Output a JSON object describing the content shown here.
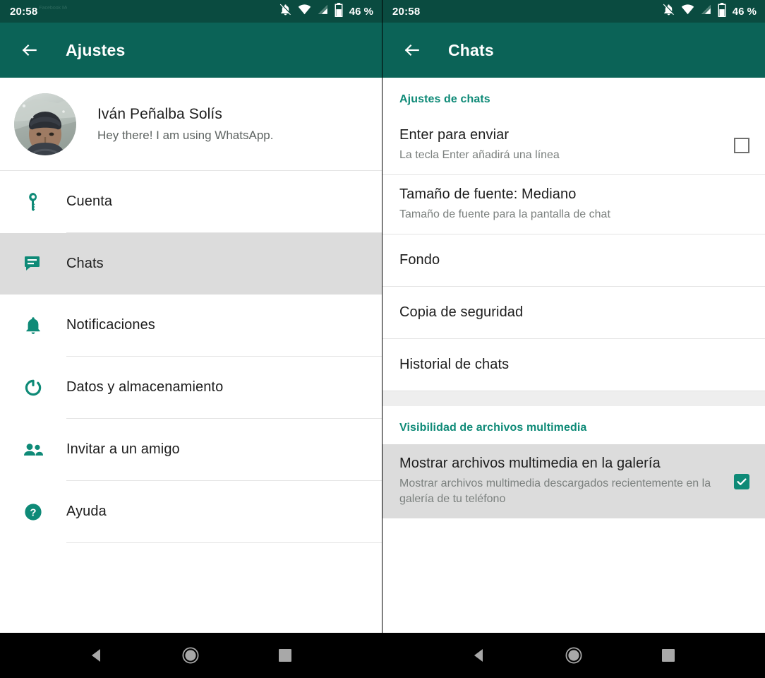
{
  "status_bar": {
    "time": "20:58",
    "ghost_text": "Facebook Messenger",
    "battery_label": "46 %",
    "icons": [
      "notifications-off-icon",
      "wifi-icon",
      "cellular-signal-icon",
      "battery-icon"
    ]
  },
  "colors": {
    "status_bar": "#0a4b40",
    "app_bar": "#0b6357",
    "accent_teal": "#0e8a77",
    "selected_row": "#dcdcdc",
    "divider": "#e4e4e4",
    "section_gap": "#eeeeee",
    "nav_bar": "#000000"
  },
  "left_pane": {
    "app_bar": {
      "title": "Ajustes",
      "back_icon": "arrow-back-icon"
    },
    "profile": {
      "name": "Iván Peñalba Solís",
      "status": "Hey there! I am using WhatsApp.",
      "avatar_alt": "profile-photo"
    },
    "menu": [
      {
        "label": "Cuenta",
        "icon": "key-icon",
        "selected": false
      },
      {
        "label": "Chats",
        "icon": "chat-bubble-icon",
        "selected": true
      },
      {
        "label": "Notificaciones",
        "icon": "bell-icon",
        "selected": false
      },
      {
        "label": "Datos y almacenamiento",
        "icon": "data-usage-icon",
        "selected": false
      },
      {
        "label": "Invitar a un amigo",
        "icon": "people-icon",
        "selected": false
      },
      {
        "label": "Ayuda",
        "icon": "help-circle-icon",
        "selected": false
      }
    ]
  },
  "right_pane": {
    "app_bar": {
      "title": "Chats",
      "back_icon": "arrow-back-icon"
    },
    "section1": {
      "header": "Ajustes de chats",
      "rows": [
        {
          "title": "Enter para enviar",
          "subtitle": "La tecla Enter añadirá una línea",
          "checkbox": "unchecked"
        },
        {
          "title": "Tamaño de fuente: Mediano",
          "subtitle": "Tamaño de fuente para la pantalla de chat",
          "checkbox": "none"
        },
        {
          "title": "Fondo",
          "subtitle": "",
          "checkbox": "none"
        },
        {
          "title": "Copia de seguridad",
          "subtitle": "",
          "checkbox": "none"
        },
        {
          "title": "Historial de chats",
          "subtitle": "",
          "checkbox": "none"
        }
      ]
    },
    "section2": {
      "header": "Visibilidad de archivos multimedia",
      "rows": [
        {
          "title": "Mostrar archivos multimedia en la galería",
          "subtitle": "Mostrar archivos multimedia descargados recientemente en la galería de tu teléfono",
          "checkbox": "checked",
          "highlight": true
        }
      ]
    }
  },
  "nav_bar": {
    "buttons": [
      {
        "name": "back",
        "icon": "triangle-back-icon"
      },
      {
        "name": "home",
        "icon": "circle-home-icon"
      },
      {
        "name": "recents",
        "icon": "square-recents-icon"
      }
    ]
  }
}
